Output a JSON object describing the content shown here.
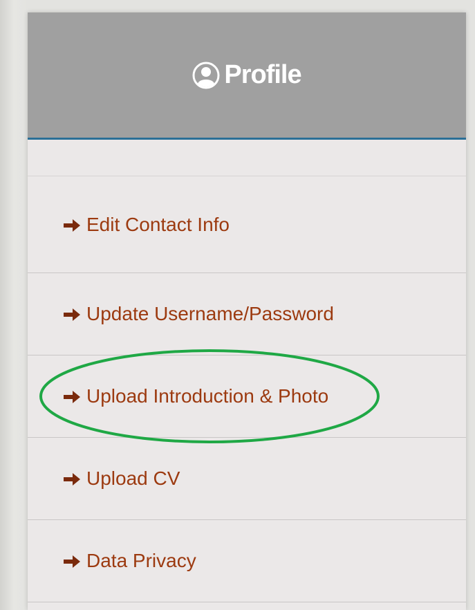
{
  "header": {
    "title": "Profile",
    "icon": "user-circle-icon",
    "background_color": "#a0a0a0",
    "accent_color": "#2a6f97"
  },
  "menu": {
    "items": [
      {
        "label": "Edit Contact Info",
        "icon": "arrow-right-icon"
      },
      {
        "label": "Update Username/Password",
        "icon": "arrow-right-icon"
      },
      {
        "label": "Upload Introduction & Photo",
        "icon": "arrow-right-icon",
        "highlighted": true
      },
      {
        "label": "Upload CV",
        "icon": "arrow-right-icon"
      },
      {
        "label": "Data Privacy",
        "icon": "arrow-right-icon"
      }
    ],
    "link_color": "#9c3a10"
  },
  "annotation": {
    "type": "ellipse",
    "color": "#1fa845",
    "target": "Upload Introduction & Photo"
  }
}
